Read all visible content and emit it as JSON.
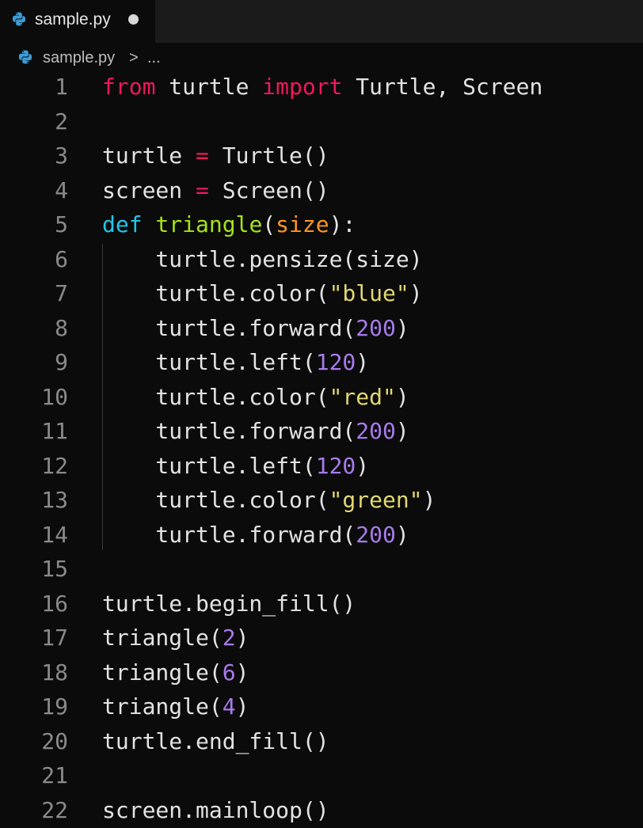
{
  "tab": {
    "filename": "sample.py"
  },
  "breadcrumb": {
    "file": "sample.py",
    "separator": ">",
    "more": "..."
  },
  "lines": [
    {
      "n": "1",
      "tokens": [
        [
          "from",
          "kw-red"
        ],
        [
          " turtle ",
          ""
        ],
        [
          "import",
          "kw-red"
        ],
        [
          " Turtle, Screen",
          ""
        ]
      ]
    },
    {
      "n": "2",
      "tokens": []
    },
    {
      "n": "3",
      "tokens": [
        [
          "turtle ",
          ""
        ],
        [
          "=",
          "op"
        ],
        [
          " Turtle()",
          ""
        ]
      ]
    },
    {
      "n": "4",
      "tokens": [
        [
          "screen ",
          ""
        ],
        [
          "=",
          "op"
        ],
        [
          " Screen()",
          ""
        ]
      ]
    },
    {
      "n": "5",
      "tokens": [
        [
          "def",
          "kw-def"
        ],
        [
          " ",
          ""
        ],
        [
          "triangle",
          "fn"
        ],
        [
          "(",
          ""
        ],
        [
          "size",
          "param"
        ],
        [
          "):",
          ""
        ]
      ]
    },
    {
      "n": "6",
      "tokens": [
        [
          "    turtle.pensize(size)",
          ""
        ]
      ]
    },
    {
      "n": "7",
      "tokens": [
        [
          "    turtle.color(",
          ""
        ],
        [
          "\"blue\"",
          "str"
        ],
        [
          ")",
          ""
        ]
      ]
    },
    {
      "n": "8",
      "tokens": [
        [
          "    turtle.forward(",
          ""
        ],
        [
          "200",
          "num"
        ],
        [
          ")",
          ""
        ]
      ]
    },
    {
      "n": "9",
      "tokens": [
        [
          "    turtle.left(",
          ""
        ],
        [
          "120",
          "num"
        ],
        [
          ")",
          ""
        ]
      ]
    },
    {
      "n": "10",
      "tokens": [
        [
          "    turtle.color(",
          ""
        ],
        [
          "\"red\"",
          "str"
        ],
        [
          ")",
          ""
        ]
      ]
    },
    {
      "n": "11",
      "tokens": [
        [
          "    turtle.forward(",
          ""
        ],
        [
          "200",
          "num"
        ],
        [
          ")",
          ""
        ]
      ]
    },
    {
      "n": "12",
      "tokens": [
        [
          "    turtle.left(",
          ""
        ],
        [
          "120",
          "num"
        ],
        [
          ")",
          ""
        ]
      ]
    },
    {
      "n": "13",
      "tokens": [
        [
          "    turtle.color(",
          ""
        ],
        [
          "\"green\"",
          "str"
        ],
        [
          ")",
          ""
        ]
      ]
    },
    {
      "n": "14",
      "tokens": [
        [
          "    turtle.forward(",
          ""
        ],
        [
          "200",
          "num"
        ],
        [
          ")",
          ""
        ]
      ]
    },
    {
      "n": "15",
      "tokens": []
    },
    {
      "n": "16",
      "tokens": [
        [
          "turtle.begin_fill()",
          ""
        ]
      ]
    },
    {
      "n": "17",
      "tokens": [
        [
          "triangle(",
          ""
        ],
        [
          "2",
          "num"
        ],
        [
          ")",
          ""
        ]
      ]
    },
    {
      "n": "18",
      "tokens": [
        [
          "triangle(",
          ""
        ],
        [
          "6",
          "num"
        ],
        [
          ")",
          ""
        ]
      ]
    },
    {
      "n": "19",
      "tokens": [
        [
          "triangle(",
          ""
        ],
        [
          "4",
          "num"
        ],
        [
          ")",
          ""
        ]
      ]
    },
    {
      "n": "20",
      "tokens": [
        [
          "turtle.end_fill()",
          ""
        ]
      ]
    },
    {
      "n": "21",
      "tokens": []
    },
    {
      "n": "22",
      "tokens": [
        [
          "screen.mainloop()",
          ""
        ]
      ]
    }
  ],
  "colors": {
    "background": "#0b0b0b",
    "keyword": "#f0185c",
    "def_keyword": "#1fc6ea",
    "function_name": "#a4e31c",
    "parameter": "#fd9623",
    "string": "#e2d870",
    "number": "#a77bea",
    "text": "#e3e3e3",
    "line_number": "#8a8a8a"
  },
  "icons": {
    "file_icon": "python-icon",
    "dirty_indicator": "unsaved-dot"
  }
}
